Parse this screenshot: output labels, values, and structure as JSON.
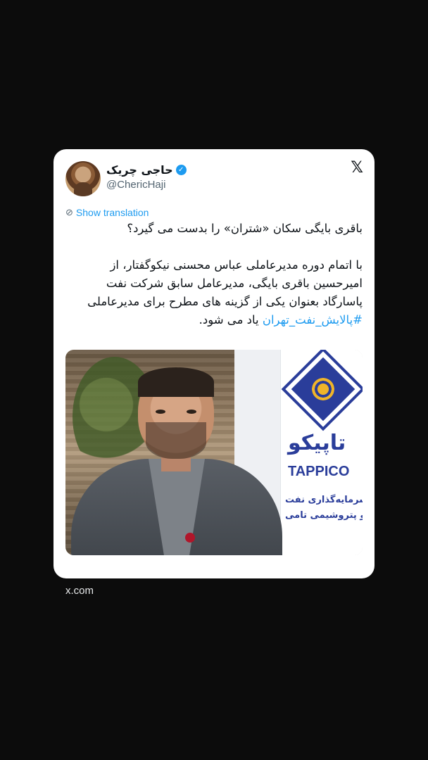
{
  "tweet": {
    "author_name": "حاجی چریک",
    "verified_mark": "✓",
    "handle": "@ChericHaji",
    "platform_icon": "x-logo-icon",
    "show_translation": "Show translation",
    "text_line_1": "باقری بایگی سکان «شتران» را بدست می گیرد؟",
    "text_line_2": "با اتمام دوره مدیرعاملی عباس محسنی نیکوگفتار، از",
    "text_line_3": "امیرحسین باقری بایگی، مدیرعامل سابق شرکت نفت",
    "text_line_4": "پاسارگاد بعنوان یکی از گزینه های مطرح برای مدیرعاملی",
    "hashtag": "#پالایش_نفت_تهران",
    "text_line_5_end": " یاد می شود.",
    "image": {
      "brand_fa": "تاپیکو",
      "brand_en": "TAPPICO",
      "brand_sub_1": "رکت سرمایه‌گذاری نفت",
      "brand_sub_2": "از و پتروشیمی تامی"
    }
  },
  "footer": {
    "domain": "x.com"
  },
  "colors": {
    "background": "#0c0c0c",
    "card": "#ffffff",
    "link": "#1d9bf0",
    "text": "#0f1419",
    "muted": "#536471"
  }
}
